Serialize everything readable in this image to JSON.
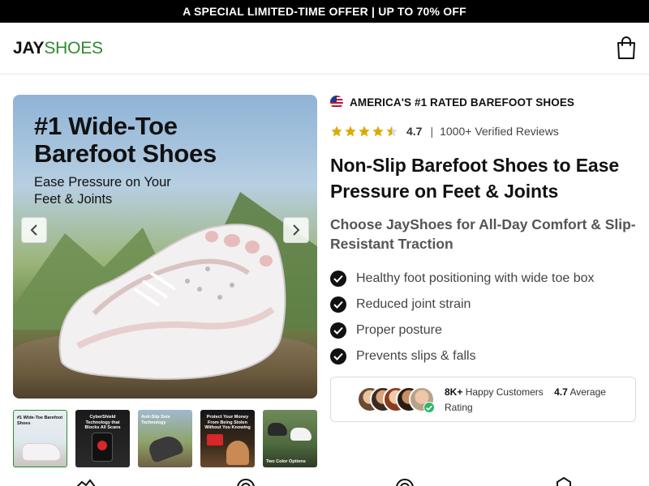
{
  "promo": {
    "text": "A SPECIAL LIMITED-TIME OFFER | UP TO 70% OFF"
  },
  "header": {
    "logo_part1": "JAY",
    "logo_part2": "SHOES",
    "cart_icon": "shopping-bag-icon"
  },
  "gallery": {
    "hero_title_line1": "#1 Wide-Toe",
    "hero_title_line2": "Barefoot Shoes",
    "hero_sub_line1": "Ease Pressure on Your",
    "hero_sub_line2": "Feet & Joints",
    "prev_icon": "chevron-left-icon",
    "next_icon": "chevron-right-icon",
    "thumbnails": [
      {
        "caption": "#1 Wide-Toe Barefoot Shoes",
        "active": true
      },
      {
        "caption": "CyberShield Technology that Blocks All Scans",
        "active": false
      },
      {
        "caption": "Anti-Slip Sole Technology",
        "active": false
      },
      {
        "caption": "Protect Your Money From Being Stolen Without You Knowing",
        "active": false
      },
      {
        "caption": "Two Color Options",
        "active": false
      }
    ]
  },
  "product": {
    "badge": "AMERICA'S #1 RATED BAREFOOT SHOES",
    "rating": {
      "value": "4.7",
      "stars": 4.5,
      "separator": "|",
      "reviews": "1000+ Verified Reviews"
    },
    "title": "Non-Slip Barefoot Shoes to Ease Pressure on Feet & Joints",
    "subtitle": "Choose JayShoes for All-Day Comfort & Slip-Resistant Traction",
    "benefits": [
      "Healthy foot positioning with wide toe box",
      "Reduced joint strain",
      "Proper posture",
      "Prevents slips & falls"
    ],
    "social": {
      "customers_count": "8K+",
      "customers_label": "Happy Customers",
      "avg_rating": "4.7",
      "avg_label": "Average Rating"
    }
  },
  "colors": {
    "brand_green": "#2f8a2f",
    "promo_bg": "#000000",
    "star": "#e0a800",
    "verified": "#2fb36a"
  }
}
